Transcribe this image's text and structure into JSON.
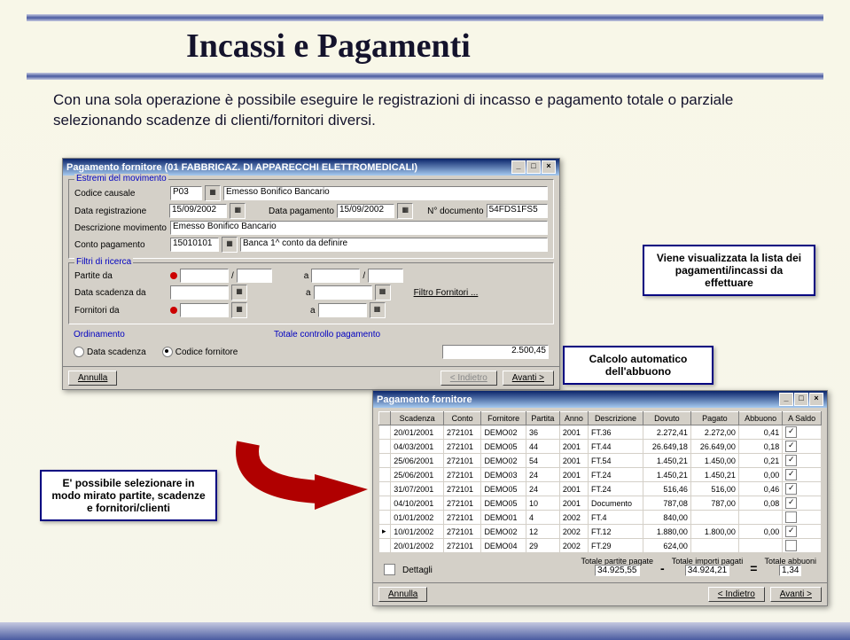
{
  "header": {
    "title": "Incassi e Pagamenti",
    "intro": "Con una sola operazione è possibile eseguire le registrazioni di incasso e pagamento totale o parziale selezionando scadenze di clienti/fornitori diversi."
  },
  "callouts": {
    "c1": "Viene visualizzata la lista dei pagamenti/incassi da effettuare",
    "c2": "Calcolo automatico dell'abbuono",
    "c3": "E' possibile selezionare in modo mirato partite, scadenze e fornitori/clienti"
  },
  "win1": {
    "title": "Pagamento fornitore (01 FABBRICAZ. DI APPARECCHI ELETTROMEDICALI)",
    "groups": {
      "estremi": "Estremi del movimento",
      "filtri": "Filtri di ricerca",
      "ordinamento": "Ordinamento"
    },
    "labels": {
      "codcaus": "Codice causale",
      "datareg": "Data registrazione",
      "datapag": "Data pagamento",
      "numdoc": "N° documento",
      "descr": "Descrizione movimento",
      "contopag": "Conto pagamento",
      "partite": "Partite da",
      "datascad": "Data scadenza da",
      "fornitori": "Fornitori da",
      "a": "a",
      "filtrofor": "Filtro Fornitori ...",
      "datascadr": "Data scadenza",
      "codfor": "Codice fornitore",
      "totctrl": "Totale controllo pagamento"
    },
    "vals": {
      "codcaus": "P03",
      "causdesc": "Emesso Bonifico Bancario",
      "datareg": "15/09/2002",
      "datapag": "15/09/2002",
      "numdoc": "54FDS1FS5",
      "descr": "Emesso Bonifico Bancario",
      "contopag": "15010101",
      "banca": "Banca 1^ conto da definire",
      "totctrl": "2.500,45"
    },
    "buttons": {
      "annulla": "Annulla",
      "indietro": "< Indietro",
      "avanti": "Avanti >"
    }
  },
  "win2": {
    "title": "Pagamento fornitore",
    "headers": [
      "",
      "Scadenza",
      "Conto",
      "Fornitore",
      "Partita",
      "Anno",
      "Descrizione",
      "Dovuto",
      "Pagato",
      "Abbuono",
      "A Saldo"
    ],
    "rows": [
      [
        "",
        "20/01/2001",
        "272101",
        "DEMO02",
        "36",
        "2001",
        "FT.36",
        "2.272,41",
        "2.272,00",
        "0,41",
        "✓"
      ],
      [
        "",
        "04/03/2001",
        "272101",
        "DEMO05",
        "44",
        "2001",
        "FT.44",
        "26.649,18",
        "26.649,00",
        "0,18",
        "✓"
      ],
      [
        "",
        "25/06/2001",
        "272101",
        "DEMO02",
        "54",
        "2001",
        "FT.54",
        "1.450,21",
        "1.450,00",
        "0,21",
        "✓"
      ],
      [
        "",
        "25/06/2001",
        "272101",
        "DEMO03",
        "24",
        "2001",
        "FT.24",
        "1.450,21",
        "1.450,21",
        "0,00",
        "✓"
      ],
      [
        "",
        "31/07/2001",
        "272101",
        "DEMO05",
        "24",
        "2001",
        "FT.24",
        "516,46",
        "516,00",
        "0,46",
        "✓"
      ],
      [
        "",
        "04/10/2001",
        "272101",
        "DEMO05",
        "10",
        "2001",
        "Documento",
        "787,08",
        "787,00",
        "0,08",
        "✓"
      ],
      [
        "",
        "01/01/2002",
        "272101",
        "DEMO01",
        "4",
        "2002",
        "FT.4",
        "840,00",
        "",
        "",
        ""
      ],
      [
        "▸",
        "10/01/2002",
        "272101",
        "DEMO02",
        "12",
        "2002",
        "FT.12",
        "1.880,00",
        "1.800,00",
        "0,00",
        "✓"
      ],
      [
        "",
        "20/01/2002",
        "272101",
        "DEMO04",
        "29",
        "2002",
        "FT.29",
        "624,00",
        "",
        "",
        ""
      ]
    ],
    "dettagli": "Dettagli",
    "totals": {
      "l1": "Totale partite pagate",
      "v1": "34.925,55",
      "l2": "Totale importi pagati",
      "v2": "34.924,21",
      "l3": "Totale abbuoni",
      "v3": "1,34"
    },
    "buttons": {
      "annulla": "Annulla",
      "indietro": "< Indietro",
      "avanti": "Avanti >"
    }
  }
}
